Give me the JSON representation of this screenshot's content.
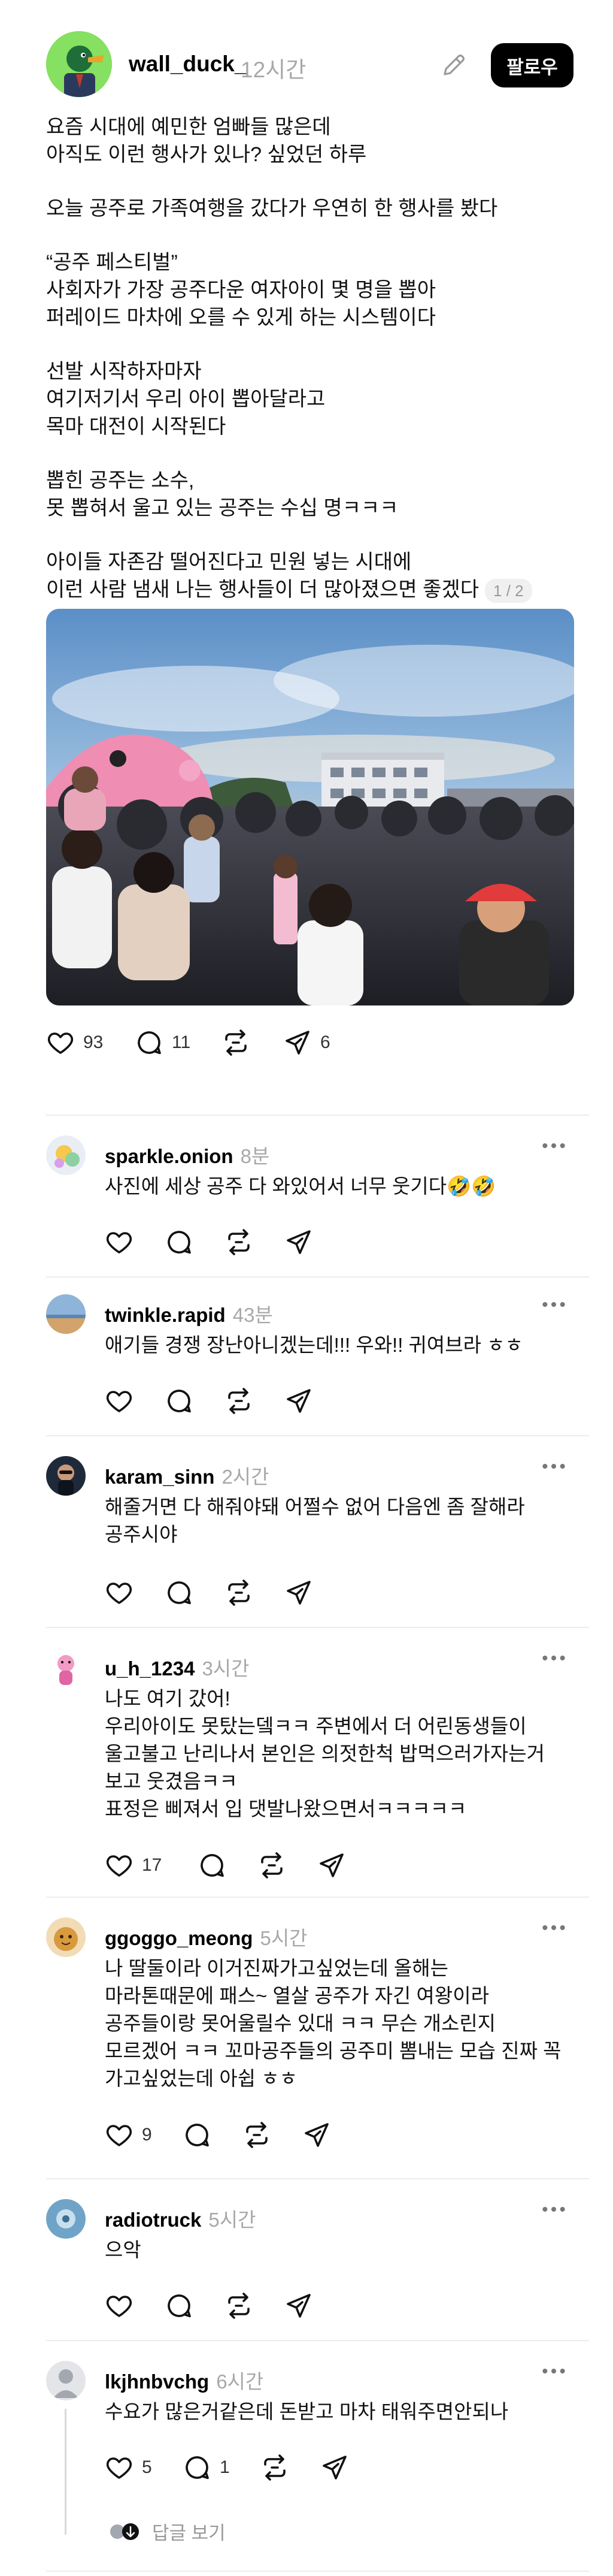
{
  "post": {
    "author": "wall_duck_",
    "time": "12시간",
    "follow_label": "팔로우",
    "paragraphs": [
      "요즘 시대에 예민한 엄빠들 많은데\n아직도 이런 행사가 있나? 싶었던 하루",
      "오늘 공주로 가족여행을 갔다가 우연히 한 행사를 봤다",
      "“공주 페스티벌”\n사회자가 가장 공주다운 여자아이 몇 명을 뽑아\n퍼레이드 마차에 오를 수 있게 하는 시스템이다",
      "선발 시작하자마자\n여기저기서 우리 아이 뽑아달라고\n목마 대전이 시작된다",
      "뽑힌 공주는 소수,\n못 뽑혀서 울고 있는 공주는 수십 명ㅋㅋㅋ",
      "아이들 자존감 떨어진다고 민원 넣는 시대에\n이런 사람 냄새 나는 행사들이 더 많아졌으면 좋겠다"
    ],
    "page_counter": "1 / 2",
    "likes": "93",
    "comments": "11",
    "shares": "6"
  },
  "comments": [
    {
      "user": "sparkle.onion",
      "time": "8분",
      "text": "사진에 세상 공주 다 와있어서 너무 웃기다🤣🤣",
      "likes": "",
      "replies": ""
    },
    {
      "user": "twinkle.rapid",
      "time": "43분",
      "text": "애기들 경쟁 장난아니겠는데!!! 우와!! 귀여브라 ㅎㅎ",
      "likes": "",
      "replies": ""
    },
    {
      "user": "karam_sinn",
      "time": "2시간",
      "text": "해줄거면 다 해줘야돼 어쩔수 없어 다음엔 좀 잘해라\n공주시야",
      "likes": "",
      "replies": ""
    },
    {
      "user": "u_h_1234",
      "time": "3시간",
      "text": "나도 여기 갔어!\n우리아이도 못탔는뎈ㅋㅋ 주변에서 더 어린동생들이\n울고불고 난리나서 본인은 의젓한척 밥먹으러가자는거\n보고 웃겼음ㅋㅋ\n표정은 삐져서 입 댓발나왔으면서ㅋㅋㅋㅋㅋ",
      "likes": "17",
      "replies": ""
    },
    {
      "user": "ggoggo_meong",
      "time": "5시간",
      "text": "나 딸둘이라 이거진짜가고싶었는데 올해는\n마라톤때문에 패스~ 열살 공주가 자긴 여왕이라\n공주들이랑 못어울릴수 있대 ㅋㅋ 무슨 개소린지\n모르겠어 ㅋㅋ 꼬마공주들의 공주미 뽐내는 모습 진짜 꼭\n가고싶었는데 아쉽 ㅎㅎ",
      "likes": "9",
      "replies": ""
    },
    {
      "user": "radiotruck",
      "time": "5시간",
      "text": "으악",
      "likes": "",
      "replies": ""
    },
    {
      "user": "lkjhnbvchg",
      "time": "6시간",
      "text": "수요가 많은거같은데 돈받고 마차 태워주면안되나",
      "likes": "5",
      "replies": "1"
    }
  ],
  "view_replies_label": "답글 보기",
  "colors": {
    "accent": "#000000",
    "muted": "#a8a8a8",
    "divider": "#ececec"
  },
  "icons": [
    "edit-icon",
    "heart-icon",
    "comment-icon",
    "repost-icon",
    "share-icon",
    "more-icon"
  ]
}
